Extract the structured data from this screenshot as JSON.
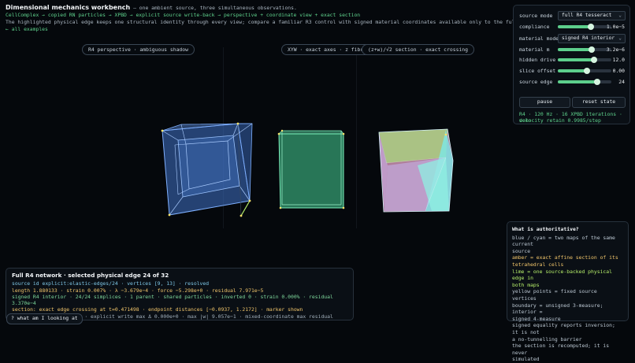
{
  "header": {
    "title": "Dimensional mechanics workbench",
    "subtitle": " — one ambient source, three simultaneous observations.",
    "pipeline": "CellComplex → copied RN particles → XPBD → explicit source write-back → perspective + coordinate view + exact section",
    "description": "The highlighted physical edge keeps one structural identity through every view; compare a familiar R3 control with signed material coordinates available only to the full R4 source.",
    "back_link": "← all examples"
  },
  "views": [
    {
      "label": "R4 perspective · ambiguous shadow"
    },
    {
      "label": "XYW · exact axes · z fibre"
    },
    {
      "label": "(z+w)/√2 section · exact crossing"
    }
  ],
  "controls": {
    "source_mode": {
      "label": "source mode",
      "value": "full R4 tesseract"
    },
    "compliance": {
      "label": "compliance",
      "value": "1.0e−5",
      "level": 0.62
    },
    "material_mode": {
      "label": "material mode",
      "value": "signed R4 interior"
    },
    "material_m": {
      "label": "material m",
      "value": "3.2e−6",
      "level": 0.63
    },
    "hidden_drive": {
      "label": "hidden drive",
      "value": "12.0",
      "level": 0.68
    },
    "slice_offset": {
      "label": "slice offset",
      "value": "0.00",
      "level": 0.55
    },
    "source_edge": {
      "label": "source edge",
      "value": "24",
      "level": 0.74
    },
    "pause_label": "pause",
    "reset_label": "reset state",
    "status_line1": "R4 · 120 Hz · 16 XPBD iterations · demo",
    "status_line2": "velocity retain 0.9985/step"
  },
  "authority": {
    "title": "What is authoritative?",
    "lines": [
      {
        "text": "blue / cyan = two maps of the same current",
        "tone": "w"
      },
      {
        "text": "source",
        "tone": "w"
      },
      {
        "text": "amber = exact affine section of its",
        "tone": "a"
      },
      {
        "text": "tetrahedral cells",
        "tone": "a"
      },
      {
        "text": "lime = one source-backed physical edge in",
        "tone": "l"
      },
      {
        "text": "both maps",
        "tone": "l"
      },
      {
        "text": "yellow points = fixed source vertices",
        "tone": "w"
      },
      {
        "text": "boundary = unsigned 3-measure; interior =",
        "tone": "w"
      },
      {
        "text": "signed 4-measure",
        "tone": "w"
      },
      {
        "text": "signed equality reports inversion; it is not",
        "tone": "w"
      },
      {
        "text": "a no-tunnelling barrier",
        "tone": "w"
      },
      {
        "text": "the section is recomputed; it is never",
        "tone": "w"
      },
      {
        "text": "simulated",
        "tone": "w"
      }
    ]
  },
  "network": {
    "title": "Full R4 network · selected physical edge 24 of 32",
    "line1": "source id explicit:elastic-edges/24 · vertices [9, 13] · resolved",
    "line2": "length 1.880133 · strain 0.007% · λ −3.679e−4 · force −5.298e+0 · residual 7.971e−5",
    "line3": "signed R4 interior · 24/24 simplices · 1 parent · shared particles · inverted 0 · strain 0.000% · residual 3.370e−4",
    "line4": "section: exact edge crossing at t=0.471498 · endpoint distances [−0.0937, 1.2172] · marker shown",
    "line5": "copied buffers disjoint · explicit write max Δ 0.000e+0 · max |w| 9.057e−1 · mixed-coordinate max residual 6.307e−4"
  },
  "help_label": "? what am I looking at",
  "colors": {
    "accent": "#5fd38d",
    "blue": "#5b8fe0",
    "green": "#5de0a6",
    "amber": "#f2c66b",
    "lime": "#b6ef6a"
  }
}
